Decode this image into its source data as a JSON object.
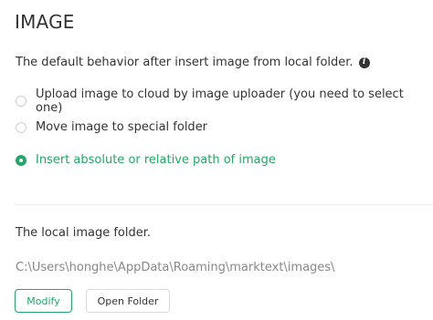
{
  "section": {
    "title": "IMAGE"
  },
  "insert_behavior": {
    "description": "The default behavior after insert image from local folder.",
    "info_icon": "info-icon",
    "options": [
      {
        "label": "Upload image to cloud by image uploader (you need to select one)",
        "checked": false
      },
      {
        "label": "Move image to special folder",
        "checked": false
      },
      {
        "label": "Insert absolute or relative path of image",
        "checked": true
      }
    ]
  },
  "local_folder": {
    "label": "The local image folder.",
    "path": "C:\\Users\\honghe\\AppData\\Roaming\\marktext\\images\\",
    "modify_label": "Modify",
    "open_label": "Open Folder"
  },
  "colors": {
    "accent": "#21a867",
    "text": "#333333",
    "muted": "#888888"
  }
}
